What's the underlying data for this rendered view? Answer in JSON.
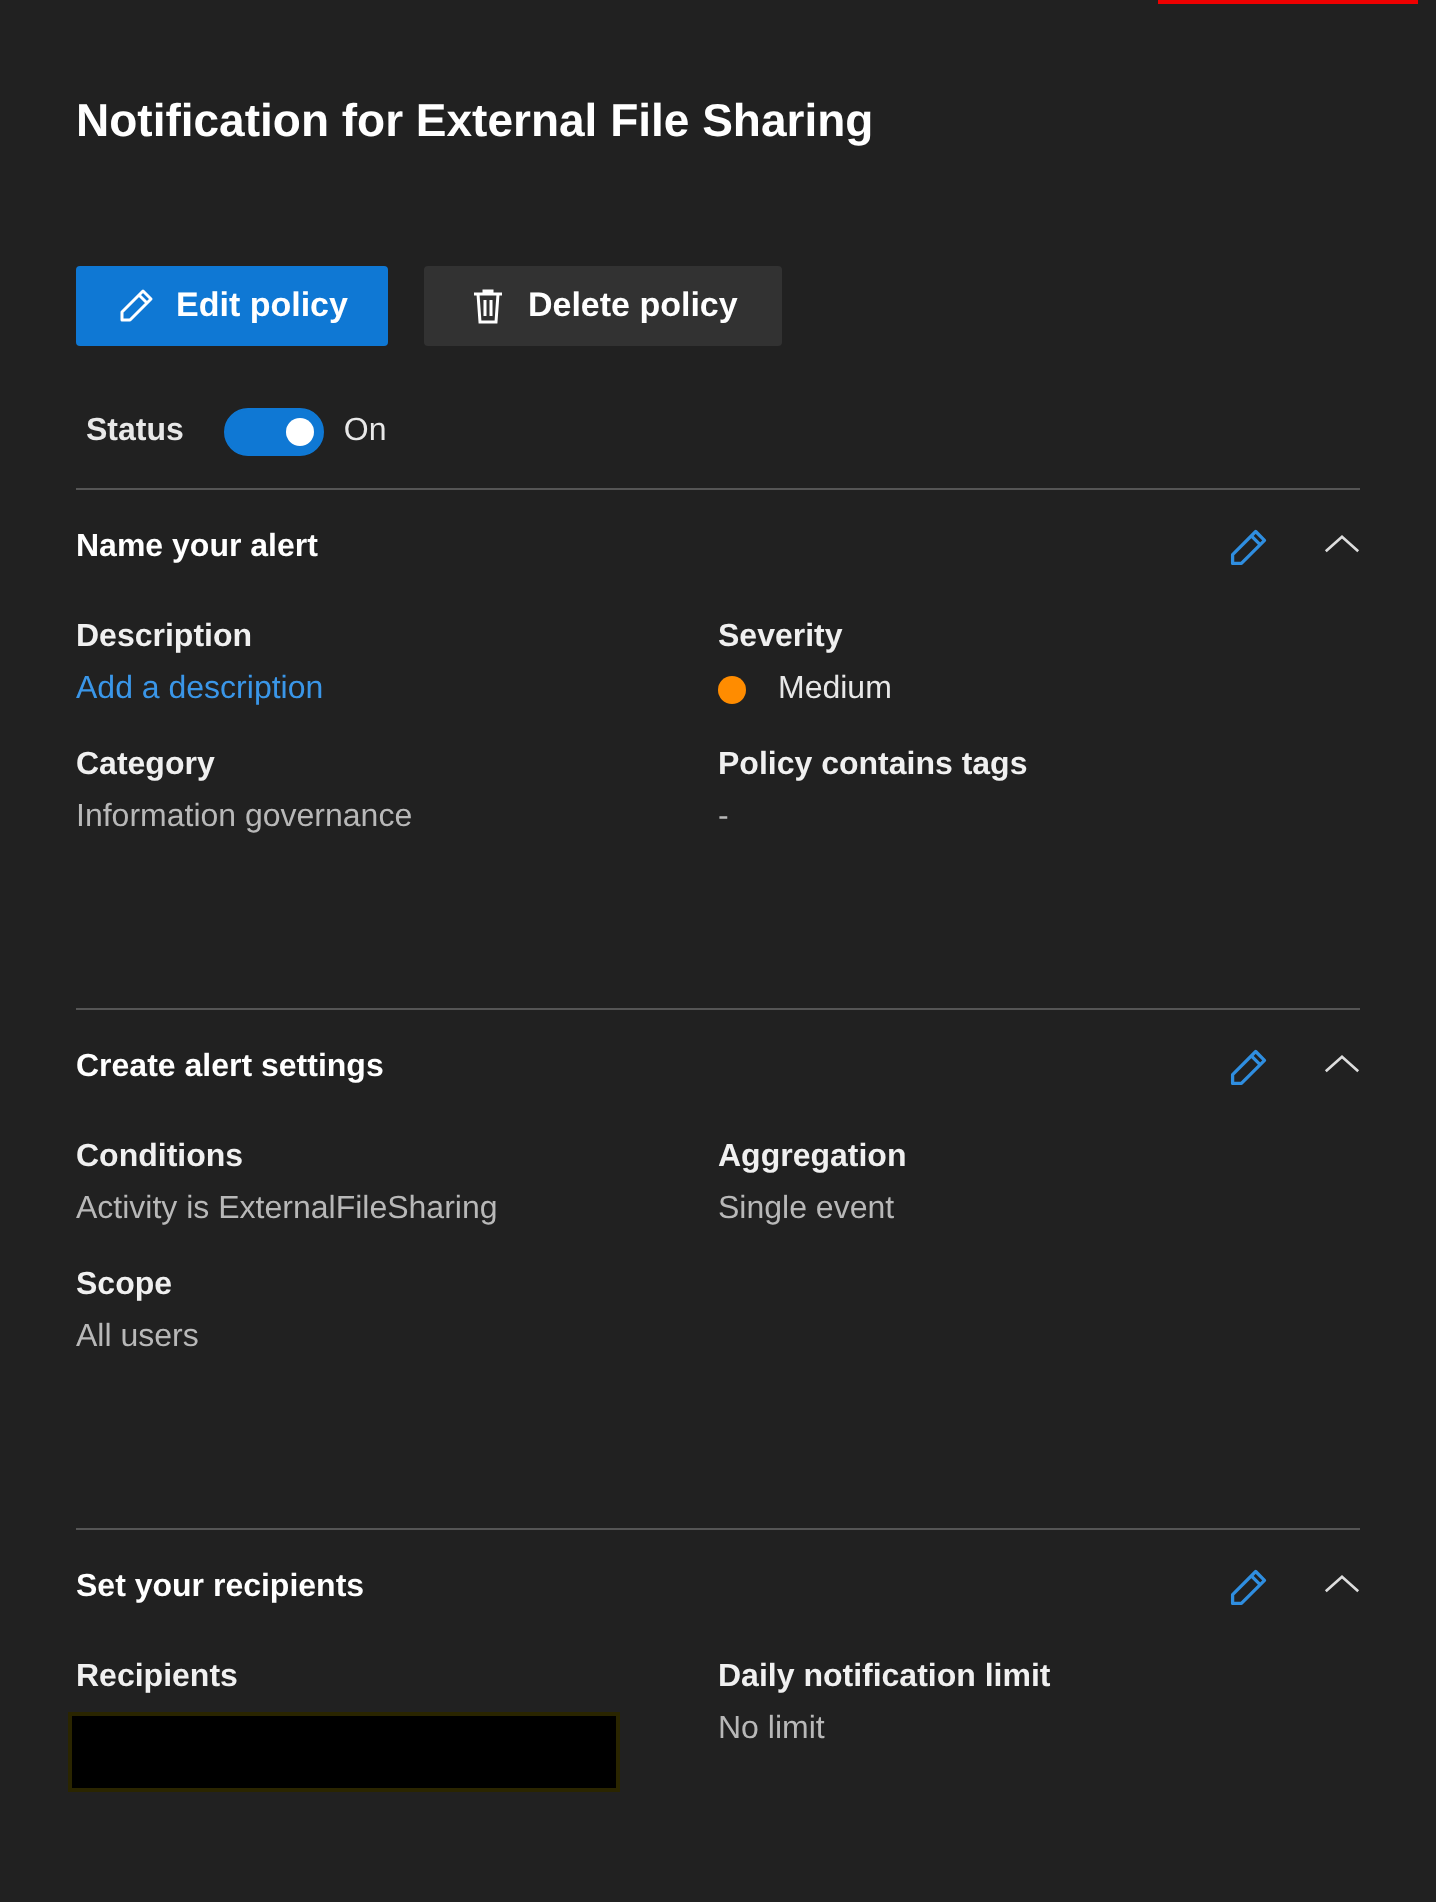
{
  "title": "Notification for External File Sharing",
  "actions": [
    {
      "kind": "edit",
      "label": "Edit policy"
    },
    {
      "kind": "delete",
      "label": "Delete policy"
    }
  ],
  "status": {
    "label": "Status",
    "on": true,
    "value": "On"
  },
  "sections": [
    {
      "title": "Name your alert",
      "expanded": true,
      "fields": [
        {
          "label": "Description",
          "kind": "link",
          "value": "Add a description"
        },
        {
          "label": "Severity",
          "kind": "severity",
          "value": "Medium",
          "color": "#ff8c00"
        },
        {
          "label": "Category",
          "kind": "text",
          "value": "Information governance"
        },
        {
          "label": "Policy contains tags",
          "kind": "text",
          "value": "-"
        }
      ]
    },
    {
      "title": "Create alert settings",
      "expanded": true,
      "fields": [
        {
          "label": "Conditions",
          "kind": "text",
          "value": "Activity is ExternalFileSharing"
        },
        {
          "label": "Aggregation",
          "kind": "text",
          "value": "Single event"
        },
        {
          "label": "Scope",
          "kind": "text",
          "value": "All users"
        }
      ]
    },
    {
      "title": "Set your recipients",
      "expanded": true,
      "fields": [
        {
          "label": "Recipients",
          "kind": "redacted"
        },
        {
          "label": "Daily notification limit",
          "kind": "text",
          "value": "No limit"
        }
      ]
    }
  ]
}
